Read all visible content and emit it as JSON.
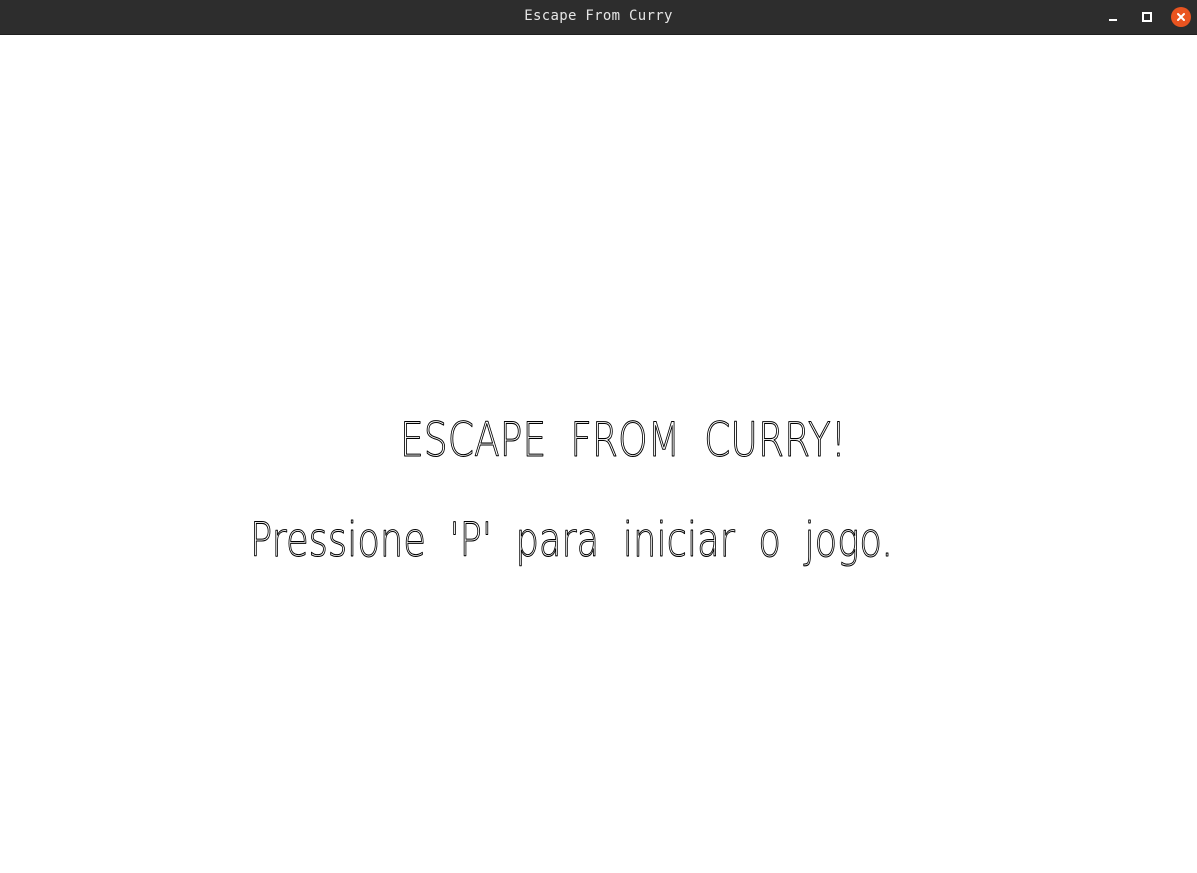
{
  "window": {
    "title": "Escape From Curry",
    "controls": {
      "minimize_icon": "minimize-icon",
      "maximize_icon": "maximize-icon",
      "close_icon": "close-icon",
      "close_color": "#e95420"
    }
  },
  "screen": {
    "background": "#ffffff",
    "heading": "ESCAPE  FROM  CURRY!",
    "prompt": "Pressione  'P'  para  iniciar  o  jogo."
  }
}
